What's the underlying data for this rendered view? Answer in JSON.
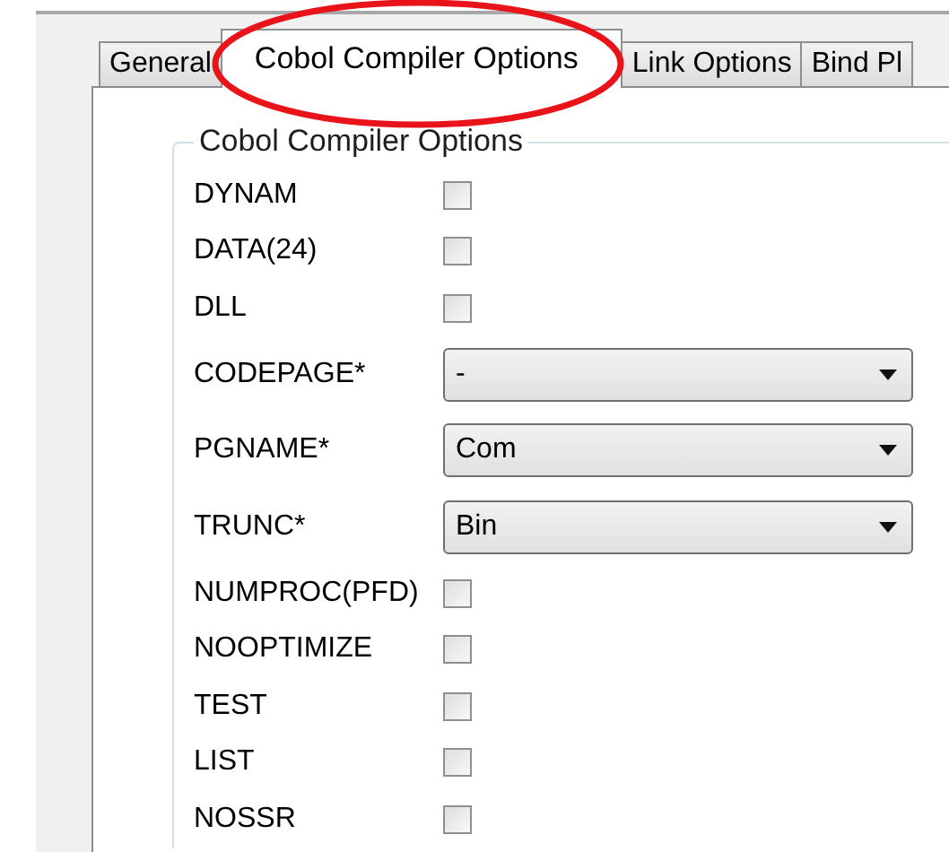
{
  "tabs": [
    {
      "label": "General",
      "selected": false
    },
    {
      "label": "Cobol Compiler Options",
      "selected": true
    },
    {
      "label": "Link Options",
      "selected": false
    },
    {
      "label": "Bind Pl",
      "selected": false
    }
  ],
  "group": {
    "title": "Cobol Compiler Options",
    "options": [
      {
        "kind": "checkbox",
        "label": "DYNAM",
        "checked": false
      },
      {
        "kind": "checkbox",
        "label": "DATA(24)",
        "checked": false
      },
      {
        "kind": "checkbox",
        "label": "DLL",
        "checked": false
      },
      {
        "kind": "select",
        "label": "CODEPAGE*",
        "value": "-"
      },
      {
        "kind": "select",
        "label": "PGNAME*",
        "value": "Com"
      },
      {
        "kind": "select",
        "label": "TRUNC*",
        "value": "Bin"
      },
      {
        "kind": "checkbox",
        "label": "NUMPROC(PFD)",
        "checked": false
      },
      {
        "kind": "checkbox",
        "label": "NOOPTIMIZE",
        "checked": false
      },
      {
        "kind": "checkbox",
        "label": "TEST",
        "checked": false
      },
      {
        "kind": "checkbox",
        "label": "LIST",
        "checked": false
      },
      {
        "kind": "checkbox",
        "label": "NOSSR",
        "checked": false
      }
    ]
  }
}
